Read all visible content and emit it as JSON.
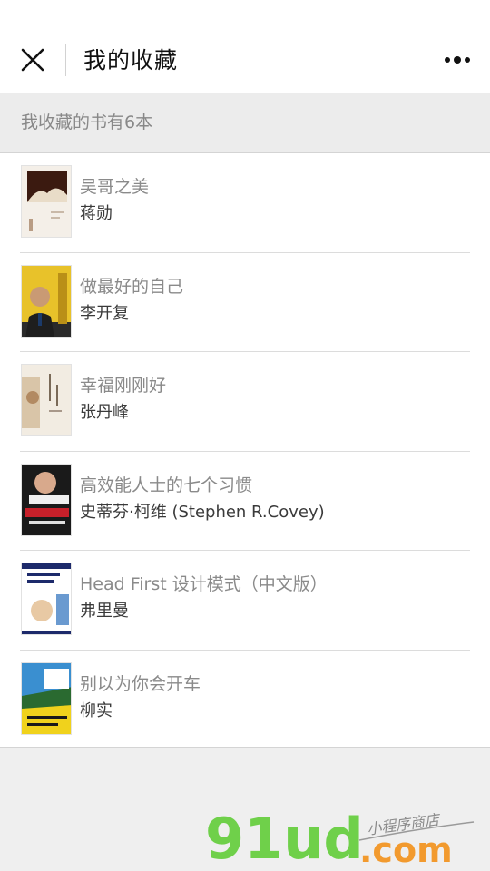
{
  "header": {
    "title": "我的收藏",
    "close_icon": "close-icon",
    "more_icon": "more-dots-icon"
  },
  "summary": {
    "text": "我收藏的书有6本"
  },
  "books": [
    {
      "title": "吴哥之美",
      "author": "蒋勋",
      "cover_colors": [
        "#f4efe8",
        "#3b1a10",
        "#c9b9a8"
      ]
    },
    {
      "title": "做最好的自己",
      "author": "李开复",
      "cover_colors": [
        "#e8c22a",
        "#2a2a2a",
        "#1b3a6a"
      ]
    },
    {
      "title": "幸福刚刚好",
      "author": "张丹峰",
      "cover_colors": [
        "#f2ece2",
        "#d1b08a",
        "#7a6a58"
      ]
    },
    {
      "title": "高效能人士的七个习惯",
      "author": "史蒂芬·柯维 (Stephen R.Covey)",
      "cover_colors": [
        "#1a1a1a",
        "#c8202a",
        "#f0f0f0"
      ]
    },
    {
      "title": "Head First 设计模式（中文版）",
      "author": "弗里曼",
      "cover_colors": [
        "#ffffff",
        "#1d2a6b",
        "#6a9ad0"
      ]
    },
    {
      "title": "别以为你会开车",
      "author": "柳实",
      "cover_colors": [
        "#f0d21c",
        "#3a8fd0",
        "#2a6a30"
      ]
    }
  ],
  "watermark": {
    "brand_primary": "91ud",
    "brand_suffix": ".com",
    "tagline": "小程序商店",
    "color_green": "#6fd04a",
    "color_orange": "#f29a2e"
  }
}
